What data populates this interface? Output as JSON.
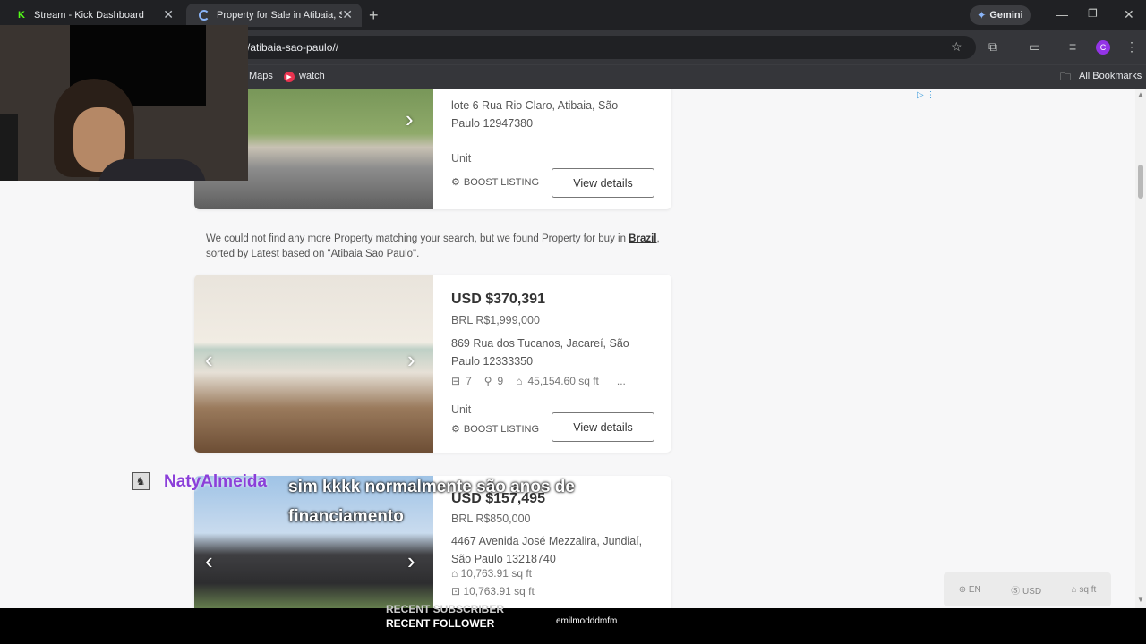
{
  "browser": {
    "tabs": [
      {
        "title": "Stream - Kick Dashboard",
        "active": false
      },
      {
        "title": "Property for Sale in Atibaia, São",
        "active": true
      }
    ],
    "gemini_label": "Gemini",
    "url": "/atibaia-sao-paulo//",
    "bookmarks": [
      "Maps",
      "watch"
    ],
    "all_bookmarks_label": "All Bookmarks",
    "profile_initial": "C"
  },
  "listings_top": {
    "address": "lote 6 Rua Rio Claro, Atibaia, São Paulo 12947380",
    "type": "Unit",
    "boost_label": "BOOST LISTING",
    "view_label": "View details"
  },
  "notice": {
    "text_before": "We could not find any more Property matching your search, but we found Property for buy in ",
    "link": "Brazil",
    "text_after": ", sorted by Latest based on \"Atibaia Sao Paulo\"."
  },
  "listing1": {
    "price_usd": "USD $370,391",
    "price_brl": "BRL R$1,999,000",
    "address": "869 Rua dos Tucanos, Jacareí, São Paulo 12333350",
    "beds": "7",
    "baths": "9",
    "area": "45,154.60 sq ft",
    "more": "...",
    "type": "Unit",
    "boost_label": "BOOST LISTING",
    "view_label": "View details"
  },
  "listing2": {
    "price_usd": "USD $157,495",
    "price_brl": "BRL R$850,000",
    "address": "4467 Avenida José Mezzalira, Jundiaí, São Paulo 13218740",
    "area1": "10,763.91 sq ft",
    "area2": "10,763.91 sq ft"
  },
  "settings_pill": {
    "lang": "EN",
    "currency": "USD",
    "unit": "sq ft"
  },
  "chat": {
    "username": "NatyAlmeida",
    "message_line1": "sim kkkk normalmente são anos de",
    "message_line2": "financiamento",
    "username_color": "#8b3fd9"
  },
  "stream_overlay": {
    "recent_subscriber_label": "RECENT SUBSCRIBER",
    "recent_follower_label": "RECENT FOLLOWER",
    "follower_name": "emilmodddmfm"
  }
}
